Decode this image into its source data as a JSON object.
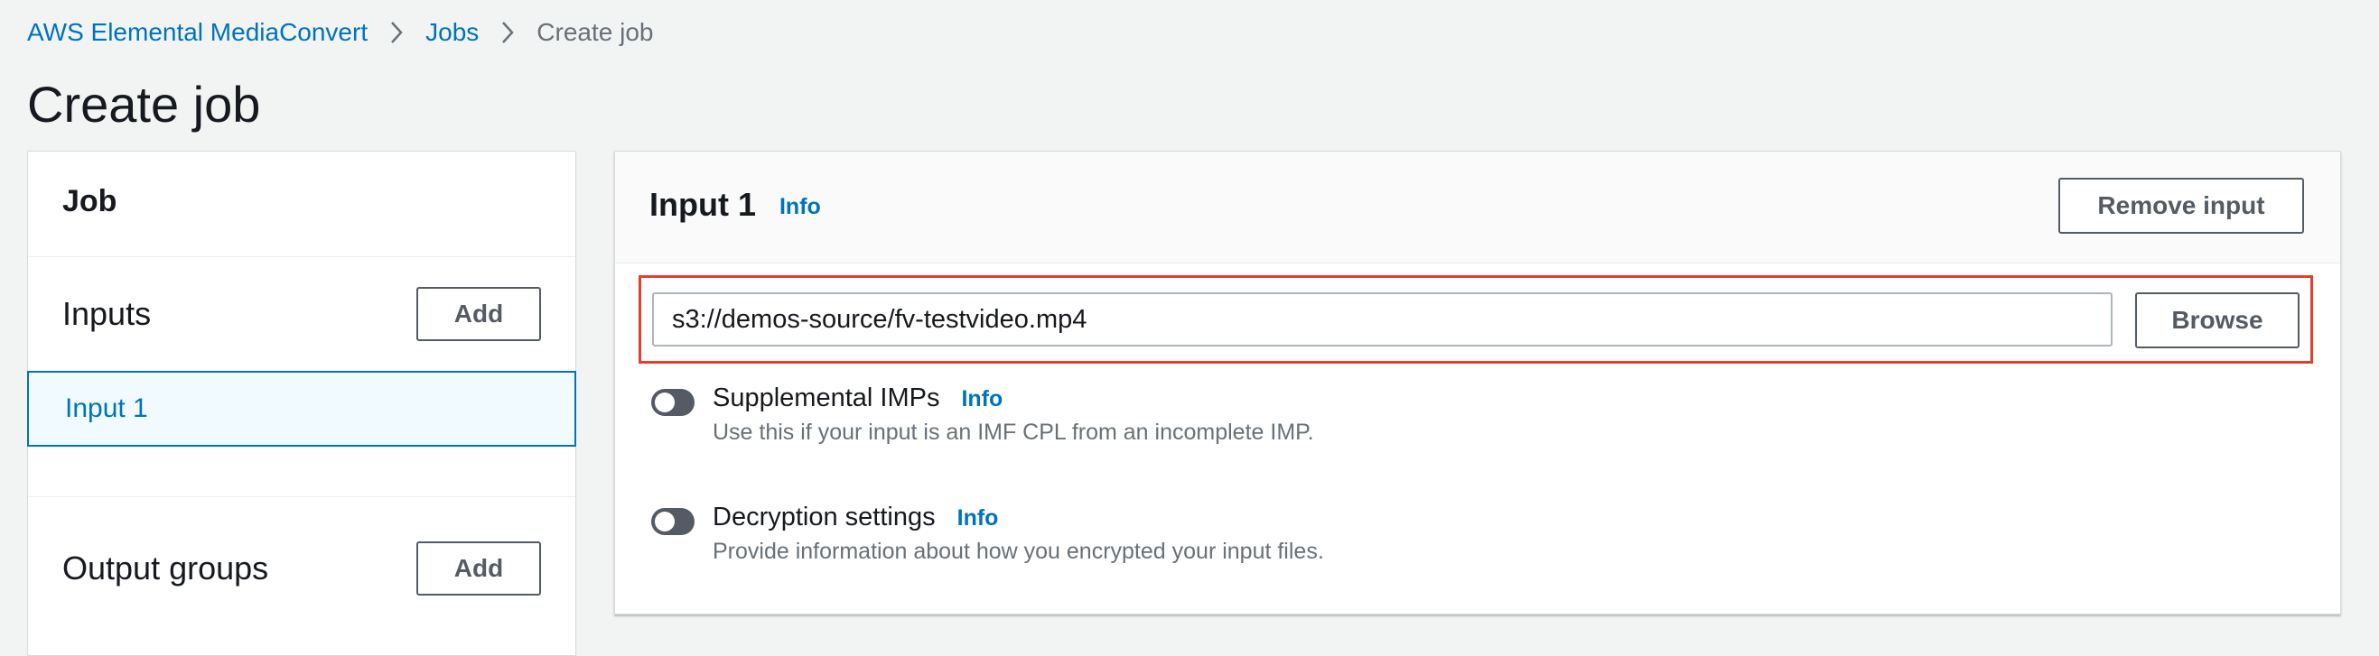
{
  "breadcrumb": {
    "items": [
      "AWS Elemental MediaConvert",
      "Jobs"
    ],
    "current": "Create job"
  },
  "page": {
    "title": "Create job"
  },
  "job_panel": {
    "title": "Job",
    "inputs_label": "Inputs",
    "inputs_add": "Add",
    "selected_input": "Input 1",
    "outputs_label": "Output groups",
    "outputs_add": "Add"
  },
  "input_panel": {
    "title": "Input 1",
    "info": "Info",
    "remove_button": "Remove input",
    "path_value": "s3://demos-source/fv-testvideo.mp4",
    "browse_button": "Browse",
    "supplemental": {
      "label": "Supplemental IMPs",
      "info": "Info",
      "description": "Use this if your input is an IMF CPL from an incomplete IMP.",
      "enabled": false
    },
    "decryption": {
      "label": "Decryption settings",
      "info": "Info",
      "description": "Provide information about how you encrypted your input files.",
      "enabled": false
    }
  },
  "colors": {
    "link": "#0073bb",
    "highlight": "#e0412c",
    "background": "#f2f3f3"
  }
}
